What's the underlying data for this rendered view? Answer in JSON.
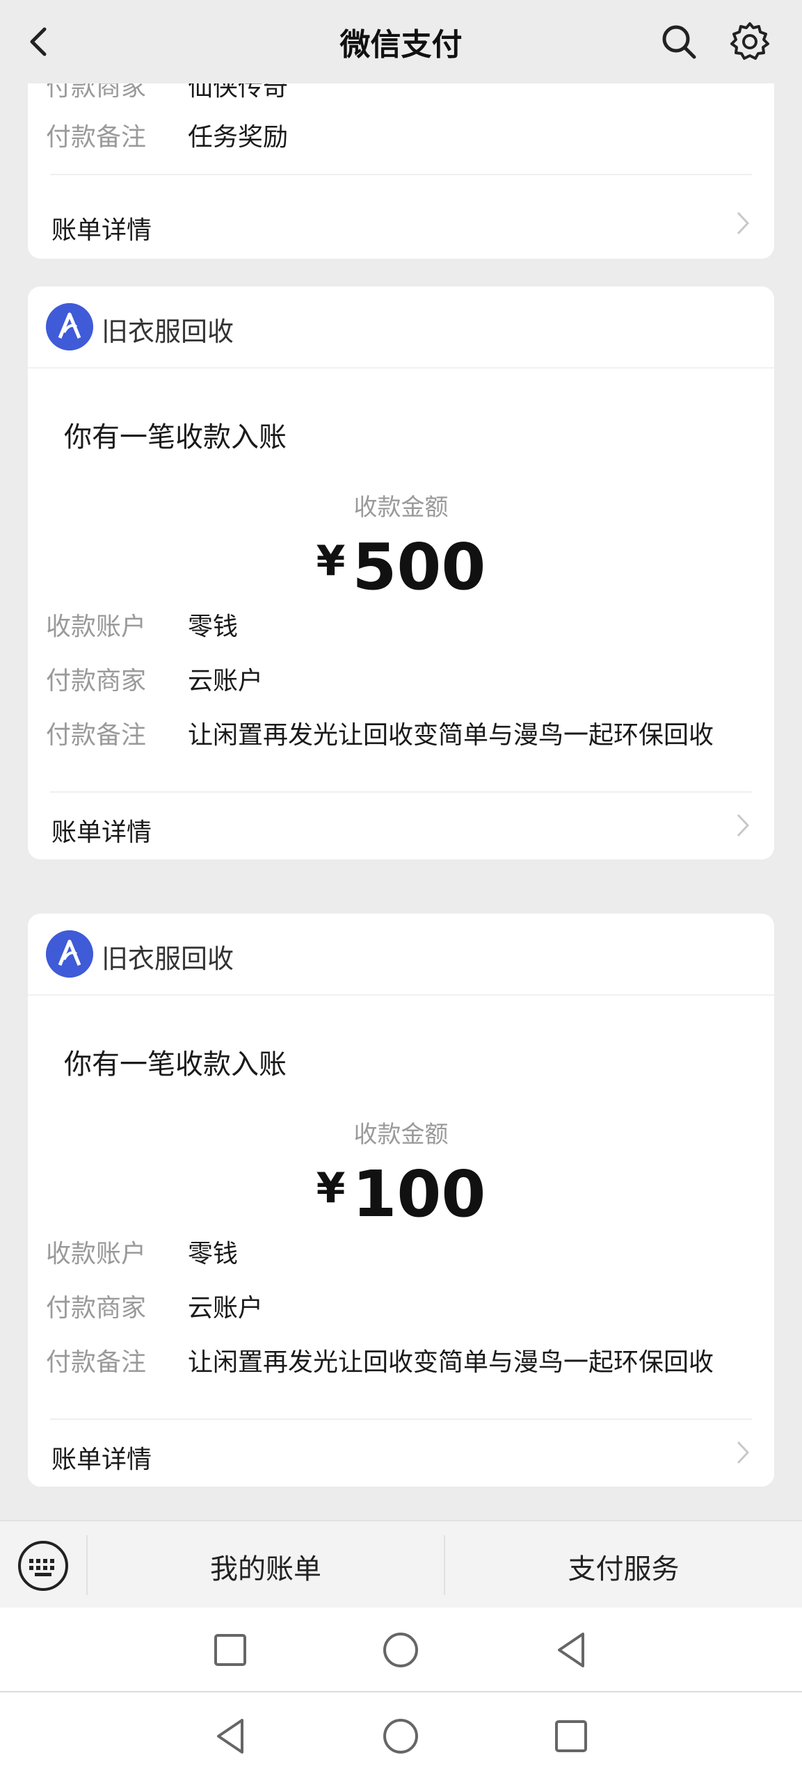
{
  "header": {
    "title": "微信支付",
    "icons": [
      "back-arrow-icon",
      "search-icon",
      "gear-icon"
    ]
  },
  "partial_card": {
    "rows": [
      {
        "label": "付款商家",
        "value": "仙侠传奇"
      },
      {
        "label": "付款备注",
        "value": "任务奖励"
      }
    ],
    "detail_label": "账单详情"
  },
  "cards": [
    {
      "merchant": "旧衣服回收",
      "headline": "你有一笔收款入账",
      "amount_label": "收款金额",
      "currency": "¥",
      "amount": "500",
      "rows": [
        {
          "label": "收款账户",
          "value": "零钱"
        },
        {
          "label": "付款商家",
          "value": "云账户"
        },
        {
          "label": "付款备注",
          "value": "让闲置再发光让回收变简单与漫鸟一起环保回收"
        }
      ],
      "detail_label": "账单详情"
    },
    {
      "merchant": "旧衣服回收",
      "headline": "你有一笔收款入账",
      "amount_label": "收款金额",
      "currency": "¥",
      "amount": "100",
      "rows": [
        {
          "label": "收款账户",
          "value": "零钱"
        },
        {
          "label": "付款商家",
          "value": "云账户"
        },
        {
          "label": "付款备注",
          "value": "让闲置再发光让回收变简单与漫鸟一起环保回收"
        }
      ],
      "detail_label": "账单详情"
    }
  ],
  "bottom_menu": {
    "items": [
      "我的账单",
      "支付服务"
    ],
    "keyboard_icon": "keyboard-icon"
  },
  "colors": {
    "background": "#ececec",
    "card": "#ffffff",
    "logo": "#3f5bd8",
    "muted_text": "#9a9a9a"
  }
}
